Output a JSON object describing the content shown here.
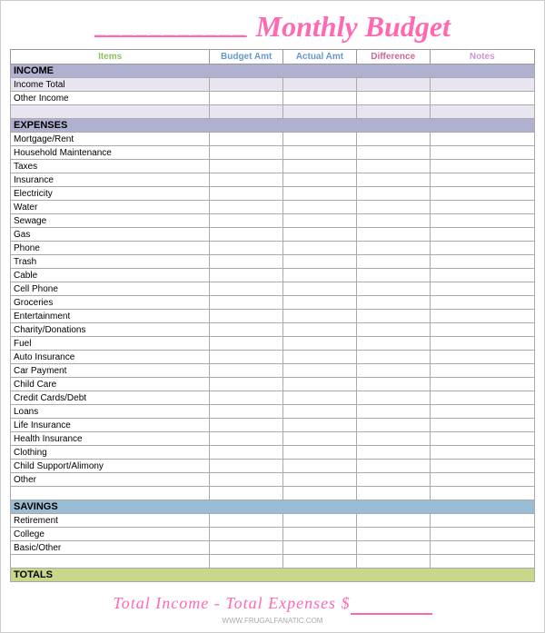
{
  "header": {
    "title": "Monthly Budget",
    "underline_text": "___________"
  },
  "columns": {
    "items": "Items",
    "budget": "Budget Amt",
    "actual": "Actual Amt",
    "difference": "Difference",
    "notes": "Notes"
  },
  "sections": {
    "income": {
      "label": "INCOME",
      "rows": [
        "Income Total",
        "Other Income",
        ""
      ]
    },
    "expenses": {
      "label": "EXPENSES",
      "rows": [
        "Mortgage/Rent",
        "Household Maintenance",
        "Taxes",
        "Insurance",
        "Electricity",
        "Water",
        "Sewage",
        "Gas",
        "Phone",
        "Trash",
        "Cable",
        "Cell Phone",
        "Groceries",
        "Entertainment",
        "Charity/Donations",
        "Fuel",
        "Auto Insurance",
        "Car Payment",
        "Child Care",
        "Credit Cards/Debt",
        "Loans",
        "Life Insurance",
        "Health Insurance",
        "Clothing",
        "Child Support/Alimony",
        "Other",
        ""
      ]
    },
    "savings": {
      "label": "SAVINGS",
      "rows": [
        "Retirement",
        "College",
        "Basic/Other",
        ""
      ]
    },
    "totals": {
      "label": "TOTALS"
    }
  },
  "footer": {
    "formula": "Total Income - Total Expenses $",
    "underline": "________",
    "credit": "WWW.FRUGALFANATIC.COM"
  }
}
